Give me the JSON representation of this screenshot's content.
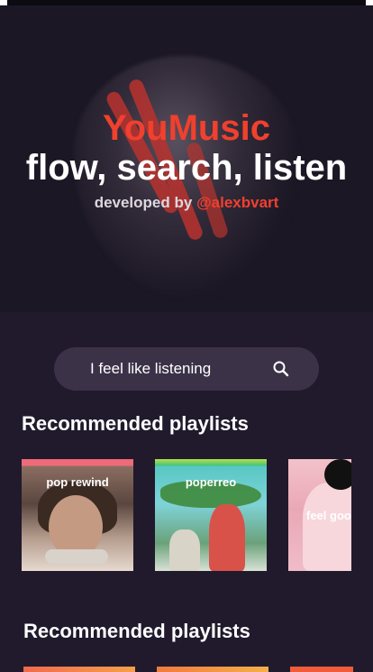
{
  "hero": {
    "app_title": "YouMusic",
    "tagline": "flow, search, listen",
    "credit_prefix": "developed by ",
    "credit_handle": "@alexbvart"
  },
  "search": {
    "label": "I feel like listening",
    "icon": "search-icon"
  },
  "sections": [
    {
      "title": "Recommended playlists",
      "playlists": [
        {
          "label": "pop rewind"
        },
        {
          "label": "poperreo"
        },
        {
          "label": "feel good"
        }
      ]
    },
    {
      "title": "Recommended playlists"
    }
  ],
  "colors": {
    "background": "#211a2c",
    "accent": "#f0402e",
    "search_bar": "#3b3248"
  }
}
